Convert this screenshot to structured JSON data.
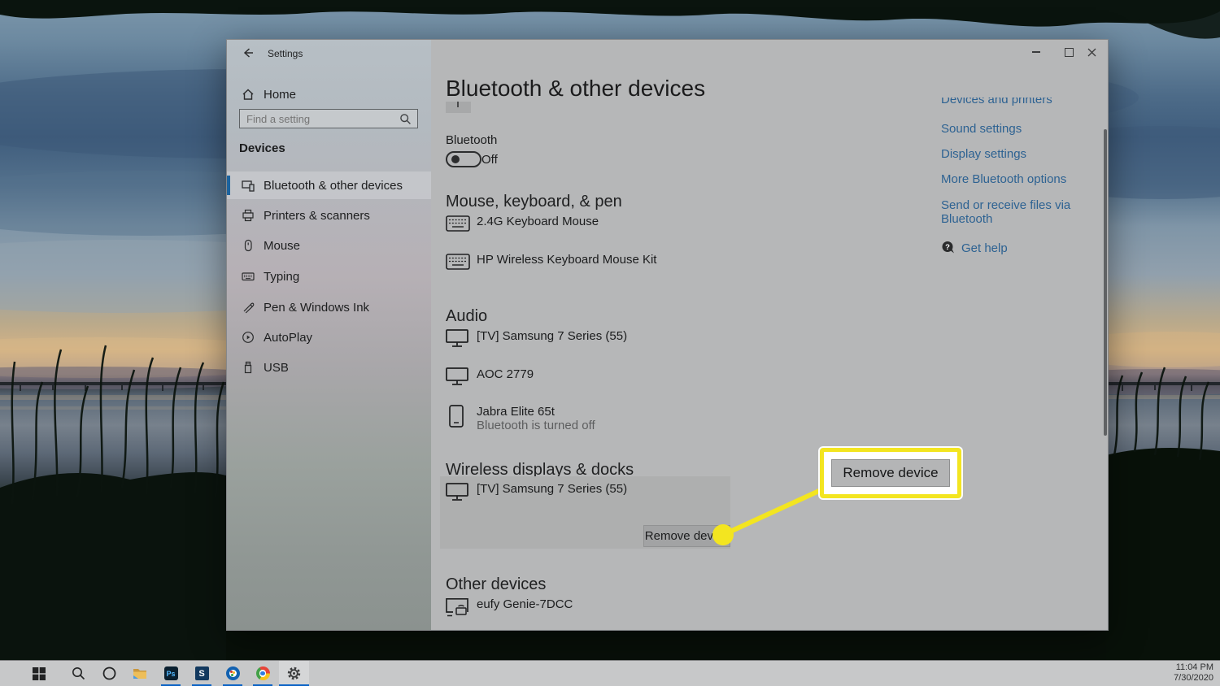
{
  "window": {
    "title": "Settings"
  },
  "header": {
    "title": "Bluetooth & other devices"
  },
  "sidebar": {
    "home": "Home",
    "search_placeholder": "Find a setting",
    "section": "Devices",
    "items": [
      {
        "label": "Bluetooth & other devices",
        "selected": true
      },
      {
        "label": "Printers & scanners"
      },
      {
        "label": "Mouse"
      },
      {
        "label": "Typing"
      },
      {
        "label": "Pen & Windows Ink"
      },
      {
        "label": "AutoPlay"
      },
      {
        "label": "USB"
      }
    ]
  },
  "bluetooth": {
    "label": "Bluetooth",
    "state": "Off"
  },
  "sections": {
    "mouse_keyboard_pen": {
      "title": "Mouse, keyboard, & pen",
      "devices": [
        "2.4G Keyboard Mouse",
        "HP Wireless Keyboard Mouse Kit"
      ]
    },
    "audio": {
      "title": "Audio",
      "devices": [
        "[TV] Samsung 7 Series (55)",
        "AOC 2779",
        "Jabra Elite 65t"
      ],
      "jabra_status": "Bluetooth is turned off"
    },
    "wireless": {
      "title": "Wireless displays & docks",
      "device": "[TV] Samsung 7 Series (55)",
      "remove_button": "Remove device"
    },
    "other": {
      "title": "Other devices",
      "device": "eufy Genie-7DCC"
    }
  },
  "related": {
    "links": [
      "Devices and printers",
      "Sound settings",
      "Display settings",
      "More Bluetooth options",
      "Send or receive files via Bluetooth"
    ],
    "get_help": "Get help",
    "help_glyph": "?"
  },
  "callout": {
    "label": "Remove device",
    "highlight_color": "#f3e520"
  },
  "taskbar": {
    "time": "11:04 PM",
    "date": "7/30/2020",
    "icon_ps": "Ps",
    "icon_s": "S"
  }
}
